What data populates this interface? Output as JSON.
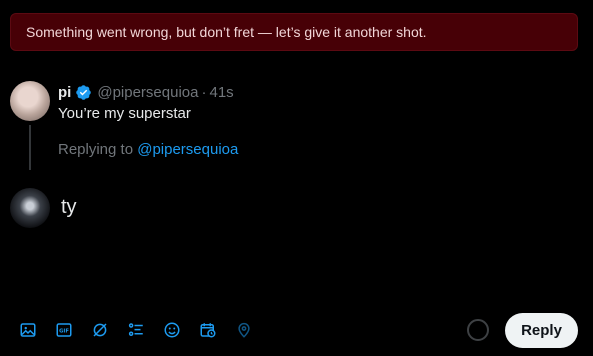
{
  "error_banner": {
    "text": "Something went wrong, but don’t fret — let’s give it another shot."
  },
  "original_tweet": {
    "name": "pi",
    "handle": "@pipersequioa",
    "separator": "·",
    "time": "41s",
    "text": "You’re my superstar"
  },
  "replying": {
    "prefix": "Replying to",
    "handle": "@pipersequioa"
  },
  "compose": {
    "text": "ty"
  },
  "toolbar": {
    "icons": [
      "image-icon",
      "gif-icon",
      "grok-icon",
      "poll-icon",
      "emoji-icon",
      "schedule-icon",
      "location-icon"
    ]
  },
  "reply_button": {
    "label": "Reply"
  },
  "colors": {
    "accent": "#1d9bf0",
    "error_bg": "#470006",
    "button_bg": "#eff3f4"
  }
}
